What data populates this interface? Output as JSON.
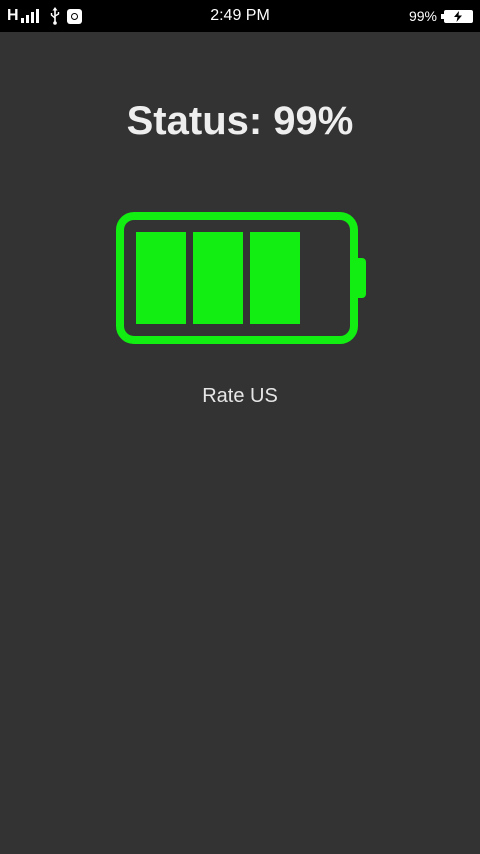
{
  "status_bar": {
    "network_type": "H",
    "time": "2:49 PM",
    "battery_percent": "99%",
    "icons": [
      "signal-strength-icon",
      "usb-icon",
      "notification-icon",
      "battery-charging-icon"
    ]
  },
  "main": {
    "title": "Status: 99%",
    "battery_level": 0.99,
    "filled_cells": 3,
    "rate_label": "Rate US"
  },
  "colors": {
    "background": "#333333",
    "status_bar": "#000000",
    "battery_green": "#12ee12",
    "text": "#eeeeee"
  }
}
